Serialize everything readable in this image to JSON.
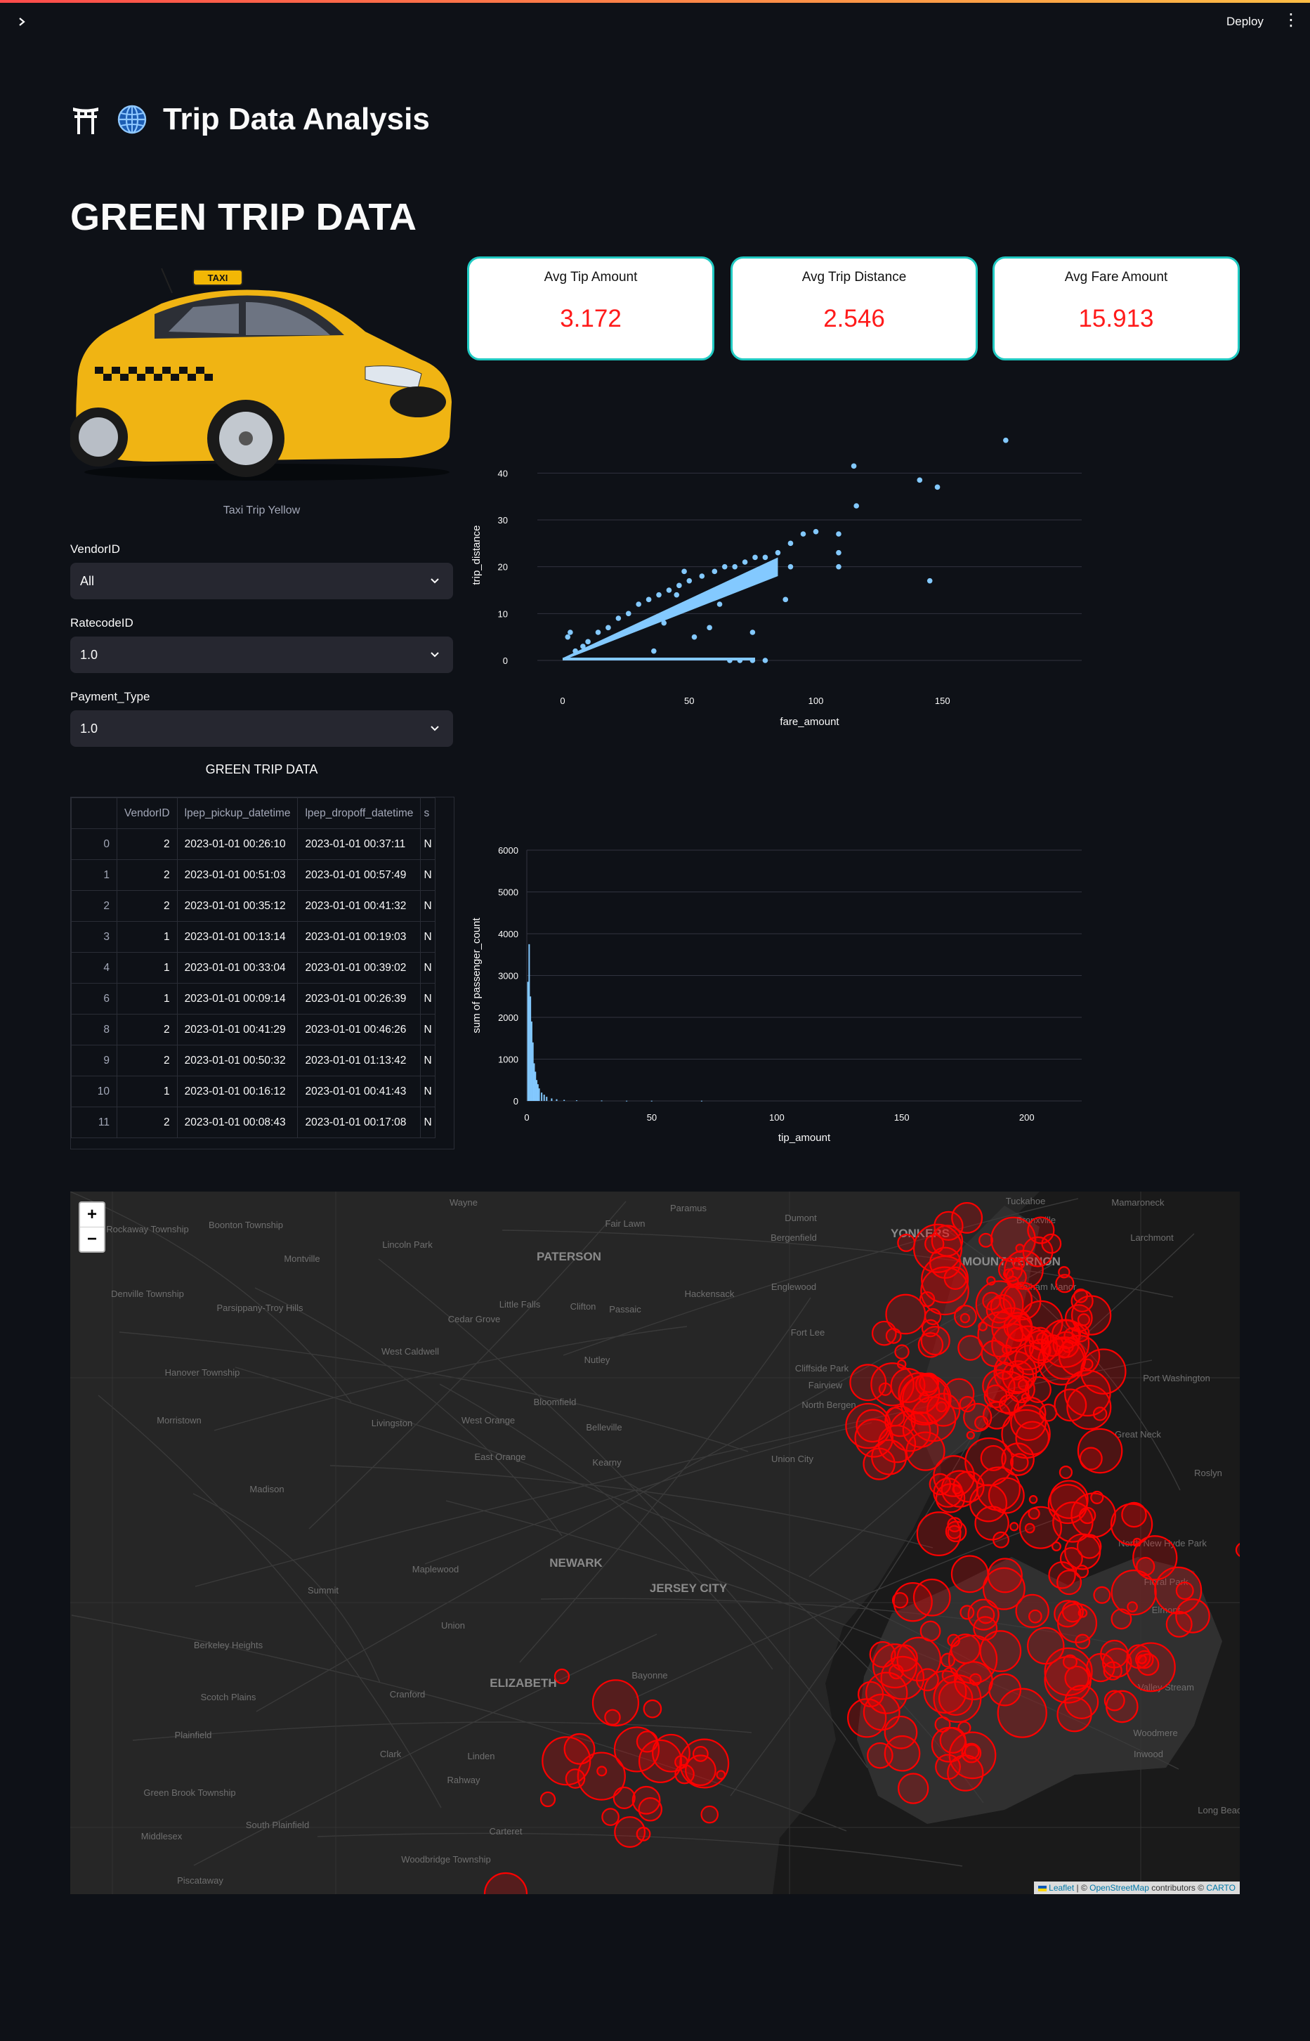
{
  "header": {
    "deploy_label": "Deploy",
    "menu_icon": "kebab-icon",
    "sidebar_icon": "chevron-right-icon"
  },
  "app": {
    "title": "Trip Data Analysis",
    "title_icons": [
      "torii-gate-icon",
      "globe-icon"
    ]
  },
  "section": {
    "title": "GREEN TRIP DATA"
  },
  "image": {
    "caption": "Taxi Trip Yellow"
  },
  "filters": {
    "vendor": {
      "label": "VendorID",
      "value": "All"
    },
    "ratecode": {
      "label": "RatecodeID",
      "value": "1.0"
    },
    "payment": {
      "label": "Payment_Type",
      "value": "1.0"
    }
  },
  "table": {
    "title": "GREEN TRIP DATA",
    "columns": [
      "",
      "VendorID",
      "lpep_pickup_datetime",
      "lpep_dropoff_datetime",
      "s"
    ],
    "rows": [
      [
        "0",
        "2",
        "2023-01-01 00:26:10",
        "2023-01-01 00:37:11",
        "N"
      ],
      [
        "1",
        "2",
        "2023-01-01 00:51:03",
        "2023-01-01 00:57:49",
        "N"
      ],
      [
        "2",
        "2",
        "2023-01-01 00:35:12",
        "2023-01-01 00:41:32",
        "N"
      ],
      [
        "3",
        "1",
        "2023-01-01 00:13:14",
        "2023-01-01 00:19:03",
        "N"
      ],
      [
        "4",
        "1",
        "2023-01-01 00:33:04",
        "2023-01-01 00:39:02",
        "N"
      ],
      [
        "6",
        "1",
        "2023-01-01 00:09:14",
        "2023-01-01 00:26:39",
        "N"
      ],
      [
        "8",
        "2",
        "2023-01-01 00:41:29",
        "2023-01-01 00:46:26",
        "N"
      ],
      [
        "9",
        "2",
        "2023-01-01 00:50:32",
        "2023-01-01 01:13:42",
        "N"
      ],
      [
        "10",
        "1",
        "2023-01-01 00:16:12",
        "2023-01-01 00:41:43",
        "N"
      ],
      [
        "11",
        "2",
        "2023-01-01 00:08:43",
        "2023-01-01 00:17:08",
        "N"
      ]
    ]
  },
  "metrics": [
    {
      "label": "Avg Tip Amount",
      "value": "3.172"
    },
    {
      "label": "Avg Trip Distance",
      "value": "2.546"
    },
    {
      "label": "Avg Fare Amount",
      "value": "15.913"
    }
  ],
  "chart_data": [
    {
      "type": "scatter",
      "xlabel": "fare_amount",
      "ylabel": "trip_distance",
      "xlim": [
        -10,
        205
      ],
      "ylim": [
        -3,
        48
      ],
      "xticks": [
        0,
        50,
        100,
        150
      ],
      "yticks": [
        0,
        10,
        20,
        30,
        40
      ],
      "color": "#83c9ff",
      "points": [
        [
          2,
          5
        ],
        [
          3,
          6
        ],
        [
          5,
          2
        ],
        [
          8,
          3
        ],
        [
          10,
          4
        ],
        [
          14,
          6
        ],
        [
          18,
          7
        ],
        [
          22,
          9
        ],
        [
          26,
          10
        ],
        [
          30,
          12
        ],
        [
          34,
          13
        ],
        [
          38,
          14
        ],
        [
          42,
          15
        ],
        [
          46,
          16
        ],
        [
          50,
          17
        ],
        [
          55,
          18
        ],
        [
          60,
          19
        ],
        [
          64,
          20
        ],
        [
          68,
          20
        ],
        [
          72,
          21
        ],
        [
          76,
          22
        ],
        [
          80,
          22
        ],
        [
          85,
          23
        ],
        [
          90,
          25
        ],
        [
          95,
          27
        ],
        [
          100,
          27.5
        ],
        [
          109,
          27
        ],
        [
          109,
          23
        ],
        [
          109,
          20
        ],
        [
          116,
          33
        ],
        [
          115,
          41.5
        ],
        [
          141,
          38.5
        ],
        [
          148,
          37
        ],
        [
          175,
          47
        ],
        [
          145,
          17
        ],
        [
          90,
          20
        ],
        [
          88,
          13
        ],
        [
          75,
          6
        ],
        [
          62,
          12
        ],
        [
          58,
          7
        ],
        [
          66,
          0
        ],
        [
          70,
          0
        ],
        [
          75,
          0
        ],
        [
          80,
          0
        ],
        [
          48,
          19
        ],
        [
          45,
          14
        ],
        [
          40,
          8
        ],
        [
          52,
          5
        ],
        [
          36,
          2
        ]
      ],
      "dense_bands": [
        {
          "x": [
            0,
            85
          ],
          "y_low": [
            0,
            18
          ],
          "y_high": [
            0.5,
            22
          ]
        },
        {
          "x": [
            0,
            76
          ],
          "y_low": [
            0,
            0
          ],
          "y_high": [
            0.6,
            0.6
          ]
        }
      ]
    },
    {
      "type": "bar",
      "xlabel": "tip_amount",
      "ylabel": "sum of passenger_count",
      "xlim": [
        0,
        222
      ],
      "ylim": [
        0,
        6000
      ],
      "xticks": [
        0,
        50,
        100,
        150,
        200
      ],
      "yticks": [
        0,
        1000,
        2000,
        3000,
        4000,
        5000,
        6000
      ],
      "color": "#83c9ff",
      "bins": [
        {
          "x": 0.5,
          "y": 2850
        },
        {
          "x": 1.0,
          "y": 3750
        },
        {
          "x": 1.5,
          "y": 2500
        },
        {
          "x": 2.0,
          "y": 1900
        },
        {
          "x": 2.5,
          "y": 1400
        },
        {
          "x": 3.0,
          "y": 900
        },
        {
          "x": 3.5,
          "y": 700
        },
        {
          "x": 4.0,
          "y": 500
        },
        {
          "x": 4.5,
          "y": 400
        },
        {
          "x": 5.0,
          "y": 300
        },
        {
          "x": 6.0,
          "y": 200
        },
        {
          "x": 7.0,
          "y": 150
        },
        {
          "x": 8.0,
          "y": 100
        },
        {
          "x": 10.0,
          "y": 60
        },
        {
          "x": 12.0,
          "y": 40
        },
        {
          "x": 15.0,
          "y": 25
        },
        {
          "x": 20.0,
          "y": 15
        },
        {
          "x": 30.0,
          "y": 10
        },
        {
          "x": 40.0,
          "y": 5
        },
        {
          "x": 50.0,
          "y": 5
        },
        {
          "x": 70.0,
          "y": 5
        }
      ]
    }
  ],
  "map": {
    "place_labels": [
      "Wayne",
      "Paramus",
      "Dumont",
      "Tuckahoe",
      "Bronxville",
      "Mamaroneck",
      "Rockaway Township",
      "Boonton Township",
      "Fair Lawn",
      "Bergenfield",
      "YONKERS",
      "Larchmont",
      "Lincoln Park",
      "Montville",
      "PATERSON",
      "MOUNT VERNON",
      "Denville Township",
      "Hackensack",
      "Englewood",
      "Pelham Manor",
      "Parsippany-Troy Hills",
      "Little Falls",
      "Clifton",
      "Passaic",
      "Cedar Grove",
      "Fort Lee",
      "West Caldwell",
      "Nutley",
      "Cliffside Park",
      "Fairview",
      "Hanover Township",
      "North Bergen",
      "Port Washington",
      "Bloomfield",
      "Morristown",
      "Livingston",
      "West Orange",
      "Belleville",
      "Great Neck",
      "Union City",
      "East Orange",
      "Kearny",
      "Madison",
      "Roslyn",
      "NEWARK",
      "North New Hyde Park",
      "Maplewood",
      "Floral Park",
      "Summit",
      "JERSEY CITY",
      "Elmont",
      "Union",
      "Berkeley Heights",
      "Bayonne",
      "Valley Stream",
      "ELIZABETH",
      "Scotch Plains",
      "Cranford",
      "Plainfield",
      "Woodmere",
      "Clark",
      "Linden",
      "Inwood",
      "Green Brook Township",
      "Rahway",
      "South Plainfield",
      "Carteret",
      "Long Beach",
      "Middlesex",
      "Woodbridge Township",
      "Piscataway"
    ],
    "zoom_in": "+",
    "zoom_out": "−",
    "attribution": {
      "leaflet": "Leaflet",
      "sep": " | © ",
      "osm": "OpenStreetMap",
      "contributors": " contributors © ",
      "carto": "CARTO"
    },
    "marker_color": "#ff0000"
  }
}
